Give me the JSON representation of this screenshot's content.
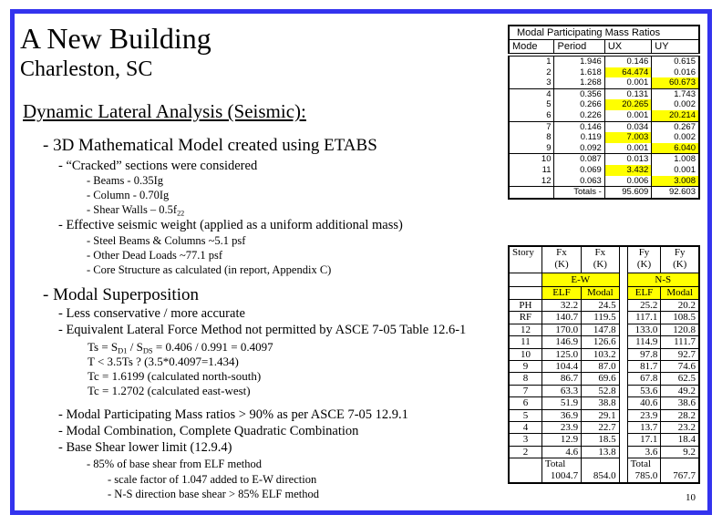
{
  "slide": {
    "title": "A New Building",
    "subtitle": "Charleston, SC",
    "section_heading": "Dynamic Lateral Analysis (Seismic):",
    "page_number": "10",
    "frame_color": "#3333ee",
    "highlight_color": "#ffff00"
  },
  "content": {
    "model": {
      "heading": "- 3D Mathematical Model created using ETABS",
      "cracked": "- “Cracked” sections were considered",
      "beams": "- Beams - 0.35Ig",
      "column": "- Column - 0.70Ig",
      "shear_walls_prefix": "- Shear Walls – 0.5f",
      "shear_walls_sub": "22",
      "weight": "- Effective seismic weight (applied as a uniform additional mass)",
      "steel": "- Steel Beams & Columns ~5.1 psf",
      "dead": "- Other Dead Loads ~77.1 psf",
      "core": "- Core Structure as calculated (in report, Appendix C)"
    },
    "modal": {
      "heading": "- Modal Superposition",
      "less_conservative": "- Less conservative / more accurate",
      "elf_not_permitted": "- Equivalent Lateral Force Method not permitted by ASCE 7-05 Table 12.6-1",
      "ts_a": "Ts = S",
      "ts_sub1": "D1",
      "ts_b": " / S",
      "ts_sub2": "DS",
      "ts_c": " = 0.406 / 0.991 =  0.4097",
      "t_check": "T < 3.5Ts ?  (3.5*0.4097=1.434)",
      "tc_ns": "Tc = 1.6199 (calculated north-south)",
      "tc_ew": "Tc = 1.2702 (calculated east-west)",
      "mass_ratio": "- Modal Participating Mass ratios > 90% as per ASCE 7-05 12.9.1",
      "combination": "- Modal Combination, Complete Quadratic Combination",
      "base_shear": "- Base Shear lower limit (12.9.4)",
      "pct85": "- 85% of base shear from ELF method",
      "scale": "- scale factor of 1.047 added to E-W direction",
      "ns": "- N-S direction base shear > 85% ELF method"
    }
  },
  "modal_table": {
    "caption": "Modal Participating Mass Ratios",
    "headers": [
      "Mode",
      "Period",
      "UX",
      "UY"
    ],
    "rows": [
      {
        "mode": "1",
        "period": "1.946",
        "ux": "0.146",
        "uy": "0.615",
        "hl_ux": false,
        "hl_uy": false
      },
      {
        "mode": "2",
        "period": "1.618",
        "ux": "64.474",
        "uy": "0.016",
        "hl_ux": true,
        "hl_uy": false
      },
      {
        "mode": "3",
        "period": "1.268",
        "ux": "0.001",
        "uy": "60.673",
        "hl_ux": false,
        "hl_uy": true
      },
      {
        "mode": "4",
        "period": "0.356",
        "ux": "0.131",
        "uy": "1.743",
        "hl_ux": false,
        "hl_uy": false
      },
      {
        "mode": "5",
        "period": "0.266",
        "ux": "20.265",
        "uy": "0.002",
        "hl_ux": true,
        "hl_uy": false
      },
      {
        "mode": "6",
        "period": "0.226",
        "ux": "0.001",
        "uy": "20.214",
        "hl_ux": false,
        "hl_uy": true
      },
      {
        "mode": "7",
        "period": "0.146",
        "ux": "0.034",
        "uy": "0.267",
        "hl_ux": false,
        "hl_uy": false
      },
      {
        "mode": "8",
        "period": "0.119",
        "ux": "7.003",
        "uy": "0.002",
        "hl_ux": true,
        "hl_uy": false
      },
      {
        "mode": "9",
        "period": "0.092",
        "ux": "0.001",
        "uy": "6.040",
        "hl_ux": false,
        "hl_uy": true
      },
      {
        "mode": "10",
        "period": "0.087",
        "ux": "0.013",
        "uy": "1.008",
        "hl_ux": false,
        "hl_uy": false
      },
      {
        "mode": "11",
        "period": "0.069",
        "ux": "3.432",
        "uy": "0.001",
        "hl_ux": true,
        "hl_uy": false
      },
      {
        "mode": "12",
        "period": "0.063",
        "ux": "0.006",
        "uy": "3.008",
        "hl_ux": false,
        "hl_uy": true
      }
    ],
    "totals_label": "Totals -",
    "totals_ux": "95.609",
    "totals_uy": "92.603"
  },
  "shear_table": {
    "headers": {
      "story": "Story",
      "fx1": "Fx",
      "fx2": "Fx",
      "fy1": "Fy",
      "fy2": "Fy",
      "unit": "(K)"
    },
    "dir_ew": "E-W",
    "dir_ns": "N-S",
    "methods": [
      "ELF",
      "Modal",
      "ELF",
      "Modal"
    ],
    "rows": [
      {
        "story": "PH",
        "ew_elf": "32.2",
        "ew_modal": "24.5",
        "ns_elf": "25.2",
        "ns_modal": "20.2"
      },
      {
        "story": "RF",
        "ew_elf": "140.7",
        "ew_modal": "119.5",
        "ns_elf": "117.1",
        "ns_modal": "108.5"
      },
      {
        "story": "12",
        "ew_elf": "170.0",
        "ew_modal": "147.8",
        "ns_elf": "133.0",
        "ns_modal": "120.8"
      },
      {
        "story": "11",
        "ew_elf": "146.9",
        "ew_modal": "126.6",
        "ns_elf": "114.9",
        "ns_modal": "111.7"
      },
      {
        "story": "10",
        "ew_elf": "125.0",
        "ew_modal": "103.2",
        "ns_elf": "97.8",
        "ns_modal": "92.7"
      },
      {
        "story": "9",
        "ew_elf": "104.4",
        "ew_modal": "87.0",
        "ns_elf": "81.7",
        "ns_modal": "74.6"
      },
      {
        "story": "8",
        "ew_elf": "86.7",
        "ew_modal": "69.6",
        "ns_elf": "67.8",
        "ns_modal": "62.5"
      },
      {
        "story": "7",
        "ew_elf": "63.3",
        "ew_modal": "52.8",
        "ns_elf": "53.6",
        "ns_modal": "49.2"
      },
      {
        "story": "6",
        "ew_elf": "51.9",
        "ew_modal": "38.8",
        "ns_elf": "40.6",
        "ns_modal": "38.6"
      },
      {
        "story": "5",
        "ew_elf": "36.9",
        "ew_modal": "29.1",
        "ns_elf": "23.9",
        "ns_modal": "28.2"
      },
      {
        "story": "4",
        "ew_elf": "23.9",
        "ew_modal": "22.7",
        "ns_elf": "13.7",
        "ns_modal": "23.2"
      },
      {
        "story": "3",
        "ew_elf": "12.9",
        "ew_modal": "18.5",
        "ns_elf": "17.1",
        "ns_modal": "18.4"
      },
      {
        "story": "2",
        "ew_elf": "4.6",
        "ew_modal": "13.8",
        "ns_elf": "3.6",
        "ns_modal": "9.2"
      }
    ],
    "totals": {
      "label": "Total",
      "ew_elf": "1004.7",
      "ew_modal": "854.0",
      "ns_elf": "785.0",
      "ns_modal": "767.7"
    }
  }
}
